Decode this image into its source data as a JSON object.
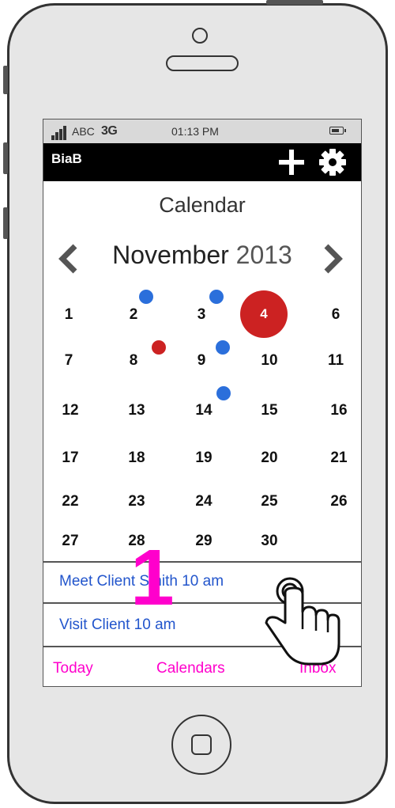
{
  "status_bar": {
    "carrier": "ABC",
    "network": "3G",
    "time": "01:13 PM"
  },
  "app_bar": {
    "app_name": "BiaB",
    "add_icon": "plus-icon",
    "settings_icon": "gear-icon"
  },
  "calendar": {
    "title": "Calendar",
    "month": "November",
    "year": "2013",
    "selected_day": "4",
    "weeks": [
      [
        "1",
        "2",
        "3",
        "4",
        "6"
      ],
      [
        "7",
        "8",
        "9",
        "10",
        "11"
      ],
      [
        "12",
        "13",
        "14",
        "15",
        "16"
      ],
      [
        "17",
        "18",
        "19",
        "20",
        "21"
      ],
      [
        "22",
        "23",
        "24",
        "25",
        "26"
      ],
      [
        "27",
        "28",
        "29",
        "30",
        ""
      ]
    ],
    "event_dot_colors": {
      "blue": "#2b6fdb",
      "red": "#cc2222"
    }
  },
  "events": [
    {
      "label": "Meet Client Smith 10 am"
    },
    {
      "label": "Visit Client 10 am"
    }
  ],
  "tabs": [
    "Today",
    "Calendars",
    "Inbox"
  ],
  "annotation": {
    "step_number": "1",
    "color": "#ff00cc"
  }
}
